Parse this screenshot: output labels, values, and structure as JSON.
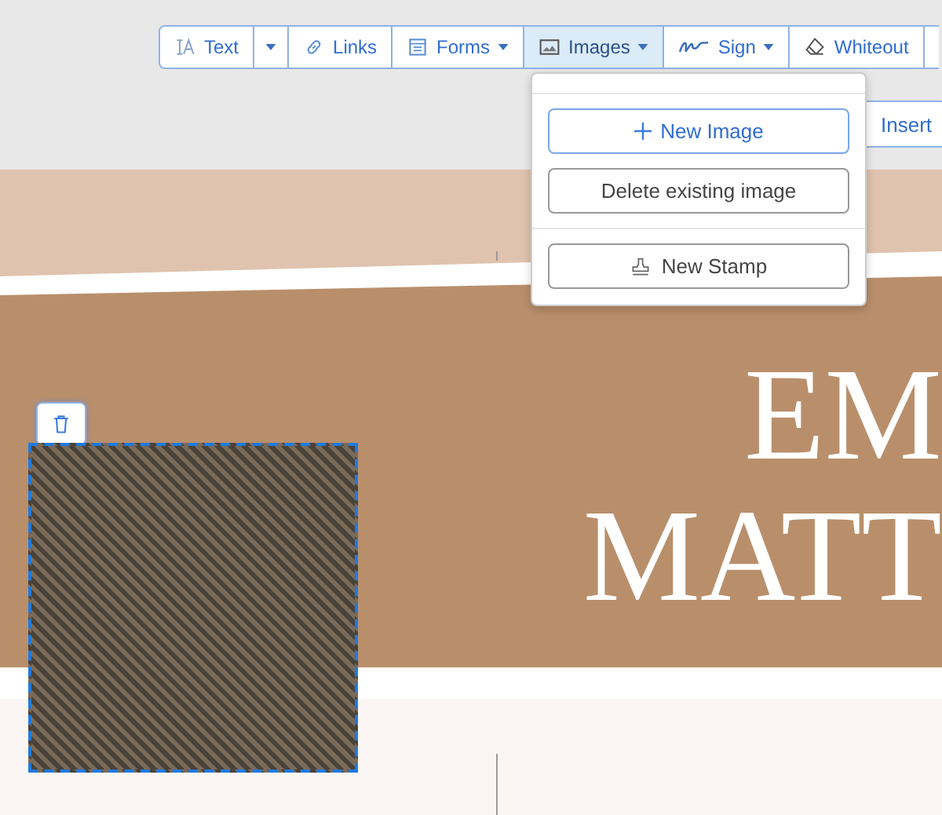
{
  "toolbar": {
    "tools": [
      {
        "kind": "tool",
        "label": "Text",
        "caret": false,
        "selected": false
      },
      {
        "kind": "caret",
        "selected": false
      },
      {
        "kind": "tool",
        "label": "Links",
        "caret": false,
        "selected": false
      },
      {
        "kind": "tool",
        "label": "Forms",
        "caret": true,
        "selected": false
      },
      {
        "kind": "tool",
        "label": "Images",
        "caret": true,
        "selected": true
      },
      {
        "kind": "tool",
        "label": "Sign",
        "caret": true,
        "selected": false
      },
      {
        "kind": "tool",
        "label": "Whiteout",
        "caret": false,
        "selected": false
      }
    ]
  },
  "secondary_button": {
    "label": "Insert"
  },
  "images_menu": {
    "items": [
      {
        "kind": "primary",
        "label": "New Image"
      },
      {
        "kind": "normal",
        "label": "Delete existing image"
      },
      {
        "kind": "divider-normal",
        "label": "New Stamp"
      }
    ]
  },
  "page": {
    "heading_lines": [
      "EM",
      "MATT"
    ]
  }
}
